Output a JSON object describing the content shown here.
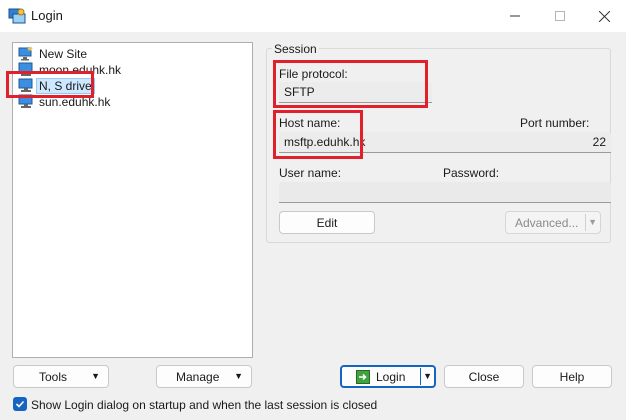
{
  "window": {
    "title": "Login"
  },
  "tree": {
    "items": [
      {
        "label": "New Site",
        "icon": "new-site-icon"
      },
      {
        "label": "moon.eduhk.hk",
        "icon": "computer-icon"
      },
      {
        "label": "N, S drive",
        "icon": "computer-icon",
        "selected": true
      },
      {
        "label": "sun.eduhk.hk",
        "icon": "computer-icon"
      }
    ]
  },
  "session": {
    "group_label": "Session",
    "file_protocol_label": "File protocol:",
    "file_protocol_value": "SFTP",
    "host_name_label": "Host name:",
    "host_name_value": "msftp.eduhk.hk",
    "port_label": "Port number:",
    "port_value": "22",
    "user_name_label": "User name:",
    "user_name_value": "",
    "password_label": "Password:",
    "password_value": "",
    "edit_label": "Edit",
    "advanced_label": "Advanced..."
  },
  "buttons": {
    "tools": "Tools",
    "manage": "Manage",
    "login": "Login",
    "close": "Close",
    "help": "Help"
  },
  "footer": {
    "show_login_label": "Show Login dialog on startup and when the last session is closed",
    "show_login_checked": true
  },
  "colors": {
    "accent": "#1565c0",
    "annotation": "#e0202a",
    "selection": "#cde8ff"
  }
}
